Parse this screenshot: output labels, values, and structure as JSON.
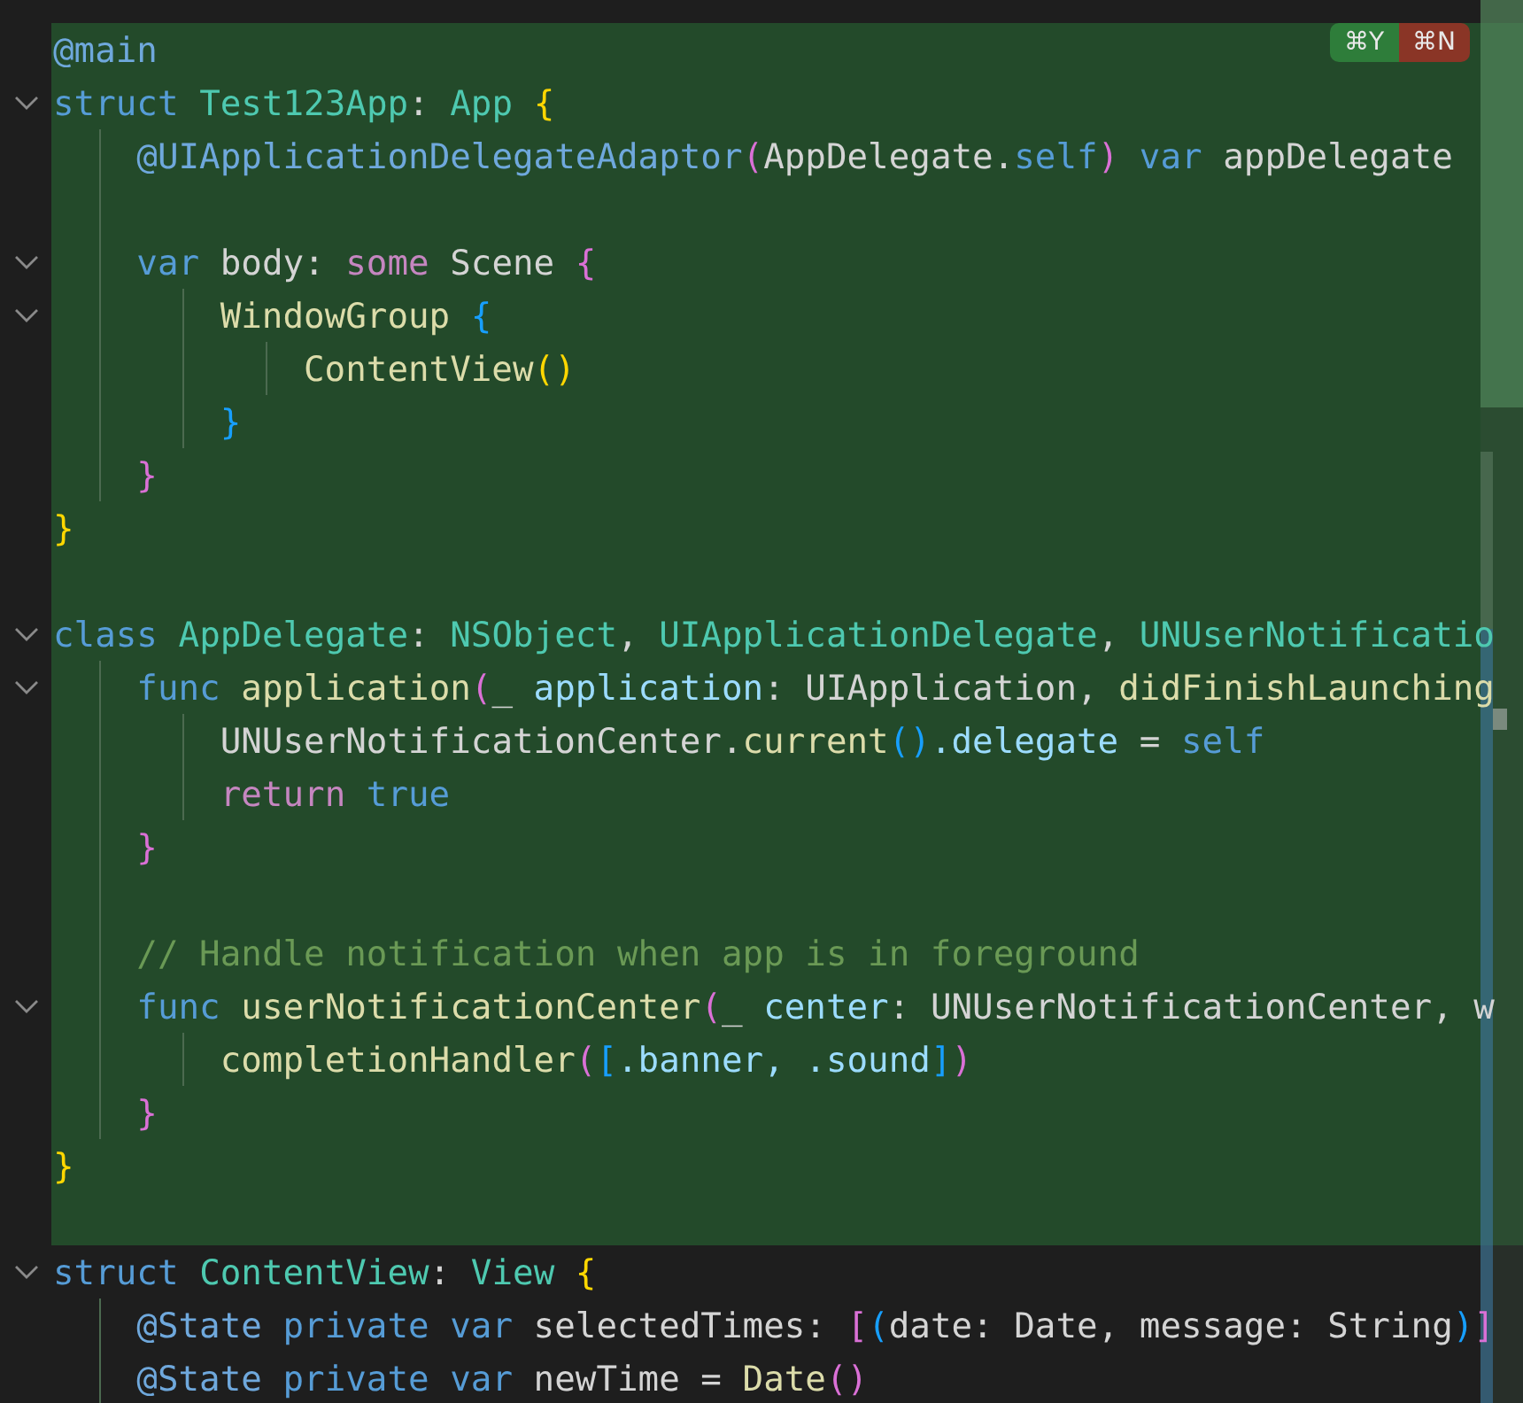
{
  "diff_actions": [
    {
      "kind": "accept",
      "label": "⌘Y"
    },
    {
      "kind": "reject",
      "label": "⌘N"
    }
  ],
  "lines": [
    {
      "kind": "code",
      "highlighted": true,
      "tokens": [
        {
          "kind": "attr",
          "text": "@main"
        }
      ]
    },
    {
      "kind": "code",
      "highlighted": true,
      "tokens": [
        {
          "kind": "kw",
          "text": "struct"
        },
        {
          "kind": "type",
          "text": " Test123App"
        },
        {
          "kind": "plain",
          "text": ":"
        },
        {
          "kind": "type",
          "text": " App"
        },
        {
          "kind": "b1",
          "text": " {"
        }
      ],
      "children": [
        {
          "kind": "code",
          "highlighted": true,
          "tokens": [
            {
              "kind": "attr",
              "text": "@UIApplicationDelegateAdaptor"
            },
            {
              "kind": "b2",
              "text": "("
            },
            {
              "kind": "plain",
              "text": "AppDelegate."
            },
            {
              "kind": "kw",
              "text": "self"
            },
            {
              "kind": "b2",
              "text": ")"
            },
            {
              "kind": "kw",
              "text": " var"
            },
            {
              "kind": "plain",
              "text": " appDelegate"
            }
          ]
        },
        {
          "kind": "blank",
          "highlighted": true
        },
        {
          "kind": "code",
          "highlighted": true,
          "tokens": [
            {
              "kind": "kw",
              "text": "var"
            },
            {
              "kind": "plain",
              "text": " body:"
            },
            {
              "kind": "kw2",
              "text": " some"
            },
            {
              "kind": "plain",
              "text": " Scene"
            },
            {
              "kind": "b2",
              "text": " {"
            }
          ],
          "children": [
            {
              "kind": "code",
              "highlighted": true,
              "tokens": [
                {
                  "kind": "fn",
                  "text": "WindowGroup"
                },
                {
                  "kind": "b3",
                  "text": " {"
                }
              ],
              "children": [
                {
                  "kind": "code",
                  "highlighted": true,
                  "tokens": [
                    {
                      "kind": "fn",
                      "text": "ContentView"
                    },
                    {
                      "kind": "b1",
                      "text": "()"
                    }
                  ]
                }
              ]
            },
            {
              "kind": "code",
              "highlighted": true,
              "tokens": [
                {
                  "kind": "b3",
                  "text": "}"
                }
              ]
            }
          ]
        },
        {
          "kind": "code",
          "highlighted": true,
          "tokens": [
            {
              "kind": "b2",
              "text": "}"
            }
          ]
        }
      ]
    },
    {
      "kind": "code",
      "highlighted": true,
      "tokens": [
        {
          "kind": "b1",
          "text": "}"
        }
      ]
    },
    {
      "kind": "blank",
      "highlighted": true
    },
    {
      "kind": "code",
      "highlighted": true,
      "tokens": [
        {
          "kind": "kw",
          "text": "class"
        },
        {
          "kind": "type",
          "text": " AppDelegate"
        },
        {
          "kind": "plain",
          "text": ":"
        },
        {
          "kind": "type",
          "text": " NSObject"
        },
        {
          "kind": "plain",
          "text": ","
        },
        {
          "kind": "type",
          "text": " UIApplicationDelegate"
        },
        {
          "kind": "plain",
          "text": ","
        },
        {
          "kind": "type",
          "text": " UNUserNotificatio"
        }
      ],
      "children": [
        {
          "kind": "code",
          "highlighted": true,
          "tokens": [
            {
              "kind": "kw",
              "text": "func"
            },
            {
              "kind": "fn",
              "text": " application"
            },
            {
              "kind": "b2",
              "text": "("
            },
            {
              "kind": "plain",
              "text": "_"
            },
            {
              "kind": "param",
              "text": " application"
            },
            {
              "kind": "plain",
              "text": ": UIApplication,"
            },
            {
              "kind": "fn",
              "text": " didFinishLaunching"
            }
          ],
          "children": [
            {
              "kind": "code",
              "highlighted": true,
              "tokens": [
                {
                  "kind": "plain",
                  "text": "UNUserNotificationCenter."
                },
                {
                  "kind": "fn",
                  "text": "current"
                },
                {
                  "kind": "b3",
                  "text": "()"
                },
                {
                  "kind": "prop",
                  "text": ".delegate"
                },
                {
                  "kind": "plain",
                  "text": " ="
                },
                {
                  "kind": "kw",
                  "text": " self"
                }
              ]
            },
            {
              "kind": "code",
              "highlighted": true,
              "tokens": [
                {
                  "kind": "kw2",
                  "text": "return"
                },
                {
                  "kind": "kw",
                  "text": " true"
                }
              ]
            }
          ]
        },
        {
          "kind": "code",
          "highlighted": true,
          "tokens": [
            {
              "kind": "b2",
              "text": "}"
            }
          ]
        },
        {
          "kind": "blank",
          "highlighted": true
        },
        {
          "kind": "code",
          "highlighted": true,
          "tokens": [
            {
              "kind": "comment",
              "text": "// Handle notification when app is in foreground"
            }
          ]
        },
        {
          "kind": "code",
          "highlighted": true,
          "tokens": [
            {
              "kind": "kw",
              "text": "func"
            },
            {
              "kind": "fn",
              "text": " userNotificationCenter"
            },
            {
              "kind": "b2",
              "text": "("
            },
            {
              "kind": "plain",
              "text": "_"
            },
            {
              "kind": "param",
              "text": " center"
            },
            {
              "kind": "plain",
              "text": ": UNUserNotificationCenter, w"
            }
          ],
          "children": [
            {
              "kind": "code",
              "highlighted": true,
              "tokens": [
                {
                  "kind": "fn",
                  "text": "completionHandler"
                },
                {
                  "kind": "b2",
                  "text": "("
                },
                {
                  "kind": "b3",
                  "text": "["
                },
                {
                  "kind": "prop",
                  "text": ".banner"
                },
                {
                  "kind": "prop",
                  "text": ", .sound"
                },
                {
                  "kind": "b3",
                  "text": "]"
                },
                {
                  "kind": "b2",
                  "text": ")"
                }
              ]
            }
          ]
        },
        {
          "kind": "code",
          "highlighted": true,
          "tokens": [
            {
              "kind": "b2",
              "text": "}"
            }
          ]
        }
      ]
    },
    {
      "kind": "code",
      "highlighted": true,
      "tokens": [
        {
          "kind": "b1",
          "text": "}"
        }
      ]
    },
    {
      "kind": "blank",
      "highlighted": true
    },
    {
      "kind": "code",
      "highlighted": false,
      "tokens": [
        {
          "kind": "kw",
          "text": "struct"
        },
        {
          "kind": "type",
          "text": " ContentView"
        },
        {
          "kind": "plain",
          "text": ":"
        },
        {
          "kind": "type",
          "text": " View"
        },
        {
          "kind": "b1",
          "text": " {"
        }
      ],
      "children": [
        {
          "kind": "code",
          "highlighted": false,
          "tokens": [
            {
              "kind": "attr",
              "text": "@State"
            },
            {
              "kind": "kw",
              "text": " private var"
            },
            {
              "kind": "plain",
              "text": " selectedTimes:"
            },
            {
              "kind": "b2",
              "text": " ["
            },
            {
              "kind": "b3",
              "text": "("
            },
            {
              "kind": "plain",
              "text": "date: Date, message: String"
            },
            {
              "kind": "b3",
              "text": ")"
            },
            {
              "kind": "b2",
              "text": "]"
            }
          ]
        },
        {
          "kind": "code",
          "highlighted": false,
          "tokens": [
            {
              "kind": "attr",
              "text": "@State"
            },
            {
              "kind": "kw",
              "text": " private var"
            },
            {
              "kind": "plain",
              "text": " newTime ="
            },
            {
              "kind": "fn",
              "text": " Date"
            },
            {
              "kind": "b2",
              "text": "()"
            }
          ]
        }
      ]
    }
  ]
}
